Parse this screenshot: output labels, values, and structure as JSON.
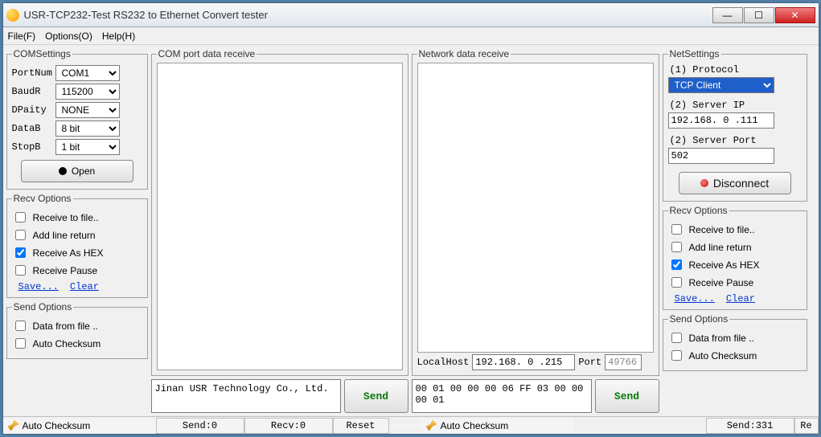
{
  "window": {
    "title": "USR-TCP232-Test  RS232 to Ethernet Convert tester"
  },
  "menu": {
    "file": "File(F)",
    "options": "Options(O)",
    "help": "Help(H)"
  },
  "com": {
    "legend": "COMSettings",
    "portnum_l": "PortNum",
    "portnum": "COM1",
    "baud_l": "BaudR",
    "baud": "115200",
    "parity_l": "DPaity",
    "parity": "NONE",
    "datab_l": "DataB",
    "datab": "8 bit",
    "stopb_l": "StopB",
    "stopb": "1 bit",
    "open": "Open"
  },
  "recv": {
    "legend": "Recv Options",
    "file": "Receive to file..",
    "lret": "Add line return",
    "hex": "Receive As HEX",
    "pause": "Receive Pause",
    "save": "Save...",
    "clear": "Clear"
  },
  "send": {
    "legend": "Send Options",
    "file": "Data from file ..",
    "ac": "Auto Checksum"
  },
  "panels": {
    "com_rx": "COM port data receive",
    "net_rx": "Network data receive",
    "localhost_l": "LocalHost",
    "localhost": "192.168. 0 .215",
    "port_l": "Port",
    "port": "49766",
    "send_com_text": "Jinan USR Technology Co., Ltd.",
    "send_net_text": "00 01 00 00 00 06 FF 03 00 00 00 01",
    "send_btn": "Send"
  },
  "net": {
    "legend": "NetSettings",
    "proto_l": "(1) Protocol",
    "proto": "TCP Client",
    "ip_l": "(2) Server IP",
    "ip": "192.168. 0 .111",
    "port_l": "(2) Server Port",
    "port": "502",
    "disc": "Disconnect"
  },
  "status": {
    "ac": "Auto Checksum",
    "send0": "Send:0",
    "recv0": "Recv:0",
    "reset": "Reset",
    "send331": "Send:331",
    "re": "Re"
  },
  "state": {
    "com_recv_hex": true,
    "net_recv_hex": true
  }
}
